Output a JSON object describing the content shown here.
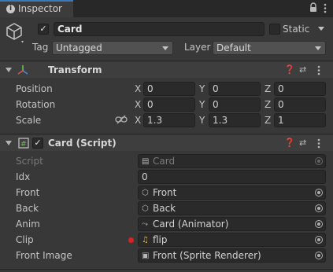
{
  "tab": {
    "title": "Inspector",
    "icon": "info-icon"
  },
  "window_controls": {
    "lock": "lock-icon",
    "menu": "kebab-menu-icon"
  },
  "gameobject": {
    "icon": "cube-icon",
    "active": true,
    "name": "Card",
    "static_label": "Static",
    "static_checked": false,
    "tag_label": "Tag",
    "tag_value": "Untagged",
    "layer_label": "Layer",
    "layer_value": "Default"
  },
  "transform": {
    "title": "Transform",
    "rows": [
      {
        "label": "Position",
        "x": "0",
        "y": "0",
        "z": "0"
      },
      {
        "label": "Rotation",
        "x": "0",
        "y": "0",
        "z": "0"
      },
      {
        "label": "Scale",
        "x": "1.3",
        "y": "1.3",
        "z": "1"
      }
    ],
    "axis": {
      "x": "X",
      "y": "Y",
      "z": "Z"
    }
  },
  "card_script": {
    "title": "Card (Script)",
    "enabled": true,
    "fields": [
      {
        "label": "Script",
        "value": "Card",
        "icon": "script-file-icon",
        "disabled": true
      },
      {
        "label": "Idx",
        "value": "0"
      },
      {
        "label": "Front",
        "value": "Front",
        "icon": "gameobject-cube-icon"
      },
      {
        "label": "Back",
        "value": "Back",
        "icon": "gameobject-cube-icon"
      },
      {
        "label": "Anim",
        "value": "Card (Animator)",
        "icon": "animator-icon"
      },
      {
        "label": "Clip",
        "value": "flip",
        "icon": "audio-clip-icon",
        "marker": "#e02020"
      },
      {
        "label": "Front Image",
        "value": "Front (Sprite Renderer)",
        "icon": "sprite-renderer-icon"
      }
    ]
  },
  "colors": {
    "accent": "#3a79bb",
    "background": "#383838",
    "field": "#2a2a2a",
    "red_marker": "#e02020"
  }
}
